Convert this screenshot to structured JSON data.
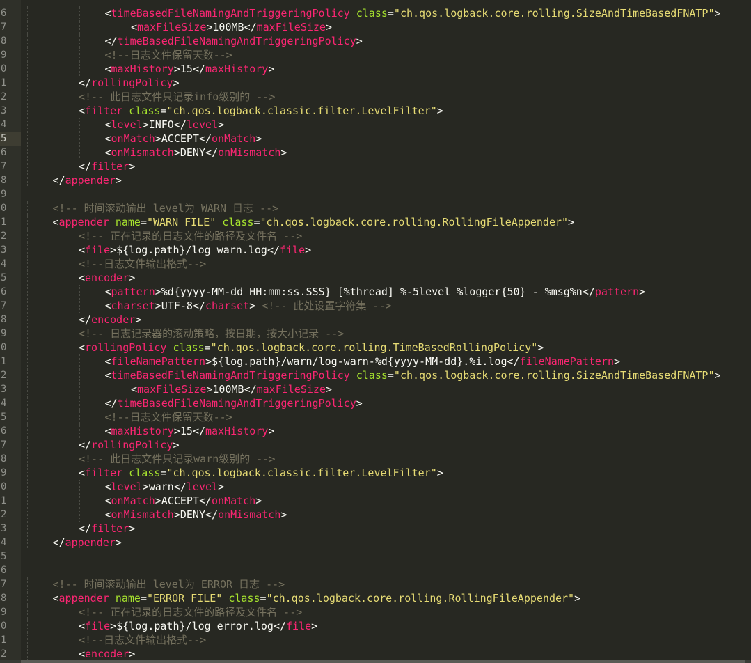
{
  "editor": {
    "active_line_index": 9,
    "lines": [
      {
        "num": "6",
        "indent": 3,
        "tokens": [
          [
            "br",
            "<"
          ],
          [
            "tag",
            "timeBasedFileNamingAndTriggeringPolicy"
          ],
          [
            "txt",
            " "
          ],
          [
            "attr",
            "class"
          ],
          [
            "br",
            "="
          ],
          [
            "str",
            "\"ch.qos.logback.core.rolling.SizeAndTimeBasedFNATP\""
          ],
          [
            "br",
            ">"
          ]
        ]
      },
      {
        "num": "7",
        "indent": 4,
        "tokens": [
          [
            "br",
            "<"
          ],
          [
            "tag",
            "maxFileSize"
          ],
          [
            "br",
            ">"
          ],
          [
            "txt",
            "100MB"
          ],
          [
            "br",
            "</"
          ],
          [
            "tag",
            "maxFileSize"
          ],
          [
            "br",
            ">"
          ]
        ]
      },
      {
        "num": "8",
        "indent": 3,
        "tokens": [
          [
            "br",
            "</"
          ],
          [
            "tag",
            "timeBasedFileNamingAndTriggeringPolicy"
          ],
          [
            "br",
            ">"
          ]
        ]
      },
      {
        "num": "9",
        "indent": 3,
        "tokens": [
          [
            "com",
            "<!--日志文件保留天数-->"
          ]
        ]
      },
      {
        "num": "0",
        "indent": 3,
        "tokens": [
          [
            "br",
            "<"
          ],
          [
            "tag",
            "maxHistory"
          ],
          [
            "br",
            ">"
          ],
          [
            "txt",
            "15"
          ],
          [
            "br",
            "</"
          ],
          [
            "tag",
            "maxHistory"
          ],
          [
            "br",
            ">"
          ]
        ]
      },
      {
        "num": "1",
        "indent": 2,
        "tokens": [
          [
            "br",
            "</"
          ],
          [
            "tag",
            "rollingPolicy"
          ],
          [
            "br",
            ">"
          ]
        ]
      },
      {
        "num": "2",
        "indent": 2,
        "tokens": [
          [
            "com",
            "<!-- 此日志文件只记录info级别的 -->"
          ]
        ]
      },
      {
        "num": "3",
        "indent": 2,
        "tokens": [
          [
            "br",
            "<"
          ],
          [
            "tag",
            "filter"
          ],
          [
            "txt",
            " "
          ],
          [
            "attr",
            "class"
          ],
          [
            "br",
            "="
          ],
          [
            "str",
            "\"ch.qos.logback.classic.filter.LevelFilter\""
          ],
          [
            "br",
            ">"
          ]
        ]
      },
      {
        "num": "4",
        "indent": 3,
        "tokens": [
          [
            "br",
            "<"
          ],
          [
            "tag",
            "level"
          ],
          [
            "br",
            ">"
          ],
          [
            "txt",
            "INFO"
          ],
          [
            "br",
            "</"
          ],
          [
            "tag",
            "level"
          ],
          [
            "br",
            ">"
          ]
        ]
      },
      {
        "num": "5",
        "indent": 3,
        "tokens": [
          [
            "br",
            "<"
          ],
          [
            "tag",
            "onMatch"
          ],
          [
            "br",
            ">"
          ],
          [
            "txt",
            "ACCEPT"
          ],
          [
            "br",
            "</"
          ],
          [
            "tag",
            "onMatch"
          ],
          [
            "br",
            ">"
          ]
        ]
      },
      {
        "num": "6",
        "indent": 3,
        "tokens": [
          [
            "br",
            "<"
          ],
          [
            "tag",
            "onMismatch"
          ],
          [
            "br",
            ">"
          ],
          [
            "txt",
            "DENY"
          ],
          [
            "br",
            "</"
          ],
          [
            "tag",
            "onMismatch"
          ],
          [
            "br",
            ">"
          ]
        ]
      },
      {
        "num": "7",
        "indent": 2,
        "tokens": [
          [
            "br",
            "</"
          ],
          [
            "tag",
            "filter"
          ],
          [
            "br",
            ">"
          ]
        ]
      },
      {
        "num": "8",
        "indent": 1,
        "tokens": [
          [
            "br",
            "</"
          ],
          [
            "tag",
            "appender"
          ],
          [
            "br",
            ">"
          ]
        ]
      },
      {
        "num": "9",
        "indent": 0,
        "tokens": []
      },
      {
        "num": "0",
        "indent": 1,
        "tokens": [
          [
            "com",
            "<!-- 时间滚动输出 level为 WARN 日志 -->"
          ]
        ]
      },
      {
        "num": "1",
        "indent": 1,
        "tokens": [
          [
            "br",
            "<"
          ],
          [
            "tag",
            "appender"
          ],
          [
            "txt",
            " "
          ],
          [
            "attr",
            "name"
          ],
          [
            "br",
            "="
          ],
          [
            "str",
            "\"WARN_FILE\""
          ],
          [
            "txt",
            " "
          ],
          [
            "attr",
            "class"
          ],
          [
            "br",
            "="
          ],
          [
            "str",
            "\"ch.qos.logback.core.rolling.RollingFileAppender\""
          ],
          [
            "br",
            ">"
          ]
        ]
      },
      {
        "num": "2",
        "indent": 2,
        "tokens": [
          [
            "com",
            "<!-- 正在记录的日志文件的路径及文件名 -->"
          ]
        ]
      },
      {
        "num": "3",
        "indent": 2,
        "tokens": [
          [
            "br",
            "<"
          ],
          [
            "tag",
            "file"
          ],
          [
            "br",
            ">"
          ],
          [
            "txt",
            "${log.path}/log_warn.log"
          ],
          [
            "br",
            "</"
          ],
          [
            "tag",
            "file"
          ],
          [
            "br",
            ">"
          ]
        ]
      },
      {
        "num": "4",
        "indent": 2,
        "tokens": [
          [
            "com",
            "<!--日志文件输出格式-->"
          ]
        ]
      },
      {
        "num": "5",
        "indent": 2,
        "tokens": [
          [
            "br",
            "<"
          ],
          [
            "tag",
            "encoder"
          ],
          [
            "br",
            ">"
          ]
        ]
      },
      {
        "num": "6",
        "indent": 3,
        "tokens": [
          [
            "br",
            "<"
          ],
          [
            "tag",
            "pattern"
          ],
          [
            "br",
            ">"
          ],
          [
            "txt",
            "%d{yyyy-MM-dd HH:mm:ss.SSS} [%thread] %-5level %logger{50} - %msg%n"
          ],
          [
            "br",
            "</"
          ],
          [
            "tag",
            "pattern"
          ],
          [
            "br",
            ">"
          ]
        ]
      },
      {
        "num": "7",
        "indent": 3,
        "tokens": [
          [
            "br",
            "<"
          ],
          [
            "tag",
            "charset"
          ],
          [
            "br",
            ">"
          ],
          [
            "txt",
            "UTF-8"
          ],
          [
            "br",
            "</"
          ],
          [
            "tag",
            "charset"
          ],
          [
            "br",
            ">"
          ],
          [
            "txt",
            " "
          ],
          [
            "com",
            "<!-- 此处设置字符集 -->"
          ]
        ]
      },
      {
        "num": "8",
        "indent": 2,
        "tokens": [
          [
            "br",
            "</"
          ],
          [
            "tag",
            "encoder"
          ],
          [
            "br",
            ">"
          ]
        ]
      },
      {
        "num": "9",
        "indent": 2,
        "tokens": [
          [
            "com",
            "<!-- 日志记录器的滚动策略，按日期，按大小记录 -->"
          ]
        ]
      },
      {
        "num": "0",
        "indent": 2,
        "tokens": [
          [
            "br",
            "<"
          ],
          [
            "tag",
            "rollingPolicy"
          ],
          [
            "txt",
            " "
          ],
          [
            "attr",
            "class"
          ],
          [
            "br",
            "="
          ],
          [
            "str",
            "\"ch.qos.logback.core.rolling.TimeBasedRollingPolicy\""
          ],
          [
            "br",
            ">"
          ]
        ]
      },
      {
        "num": "1",
        "indent": 3,
        "tokens": [
          [
            "br",
            "<"
          ],
          [
            "tag",
            "fileNamePattern"
          ],
          [
            "br",
            ">"
          ],
          [
            "txt",
            "${log.path}/warn/log-warn-%d{yyyy-MM-dd}.%i.log"
          ],
          [
            "br",
            "</"
          ],
          [
            "tag",
            "fileNamePattern"
          ],
          [
            "br",
            ">"
          ]
        ]
      },
      {
        "num": "2",
        "indent": 3,
        "tokens": [
          [
            "br",
            "<"
          ],
          [
            "tag",
            "timeBasedFileNamingAndTriggeringPolicy"
          ],
          [
            "txt",
            " "
          ],
          [
            "attr",
            "class"
          ],
          [
            "br",
            "="
          ],
          [
            "str",
            "\"ch.qos.logback.core.rolling.SizeAndTimeBasedFNATP\""
          ],
          [
            "br",
            ">"
          ]
        ]
      },
      {
        "num": "3",
        "indent": 4,
        "tokens": [
          [
            "br",
            "<"
          ],
          [
            "tag",
            "maxFileSize"
          ],
          [
            "br",
            ">"
          ],
          [
            "txt",
            "100MB"
          ],
          [
            "br",
            "</"
          ],
          [
            "tag",
            "maxFileSize"
          ],
          [
            "br",
            ">"
          ]
        ]
      },
      {
        "num": "4",
        "indent": 3,
        "tokens": [
          [
            "br",
            "</"
          ],
          [
            "tag",
            "timeBasedFileNamingAndTriggeringPolicy"
          ],
          [
            "br",
            ">"
          ]
        ]
      },
      {
        "num": "5",
        "indent": 3,
        "tokens": [
          [
            "com",
            "<!--日志文件保留天数-->"
          ]
        ]
      },
      {
        "num": "6",
        "indent": 3,
        "tokens": [
          [
            "br",
            "<"
          ],
          [
            "tag",
            "maxHistory"
          ],
          [
            "br",
            ">"
          ],
          [
            "txt",
            "15"
          ],
          [
            "br",
            "</"
          ],
          [
            "tag",
            "maxHistory"
          ],
          [
            "br",
            ">"
          ]
        ]
      },
      {
        "num": "7",
        "indent": 2,
        "tokens": [
          [
            "br",
            "</"
          ],
          [
            "tag",
            "rollingPolicy"
          ],
          [
            "br",
            ">"
          ]
        ]
      },
      {
        "num": "8",
        "indent": 2,
        "tokens": [
          [
            "com",
            "<!-- 此日志文件只记录warn级别的 -->"
          ]
        ]
      },
      {
        "num": "9",
        "indent": 2,
        "tokens": [
          [
            "br",
            "<"
          ],
          [
            "tag",
            "filter"
          ],
          [
            "txt",
            " "
          ],
          [
            "attr",
            "class"
          ],
          [
            "br",
            "="
          ],
          [
            "str",
            "\"ch.qos.logback.classic.filter.LevelFilter\""
          ],
          [
            "br",
            ">"
          ]
        ]
      },
      {
        "num": "0",
        "indent": 3,
        "tokens": [
          [
            "br",
            "<"
          ],
          [
            "tag",
            "level"
          ],
          [
            "br",
            ">"
          ],
          [
            "txt",
            "warn"
          ],
          [
            "br",
            "</"
          ],
          [
            "tag",
            "level"
          ],
          [
            "br",
            ">"
          ]
        ]
      },
      {
        "num": "1",
        "indent": 3,
        "tokens": [
          [
            "br",
            "<"
          ],
          [
            "tag",
            "onMatch"
          ],
          [
            "br",
            ">"
          ],
          [
            "txt",
            "ACCEPT"
          ],
          [
            "br",
            "</"
          ],
          [
            "tag",
            "onMatch"
          ],
          [
            "br",
            ">"
          ]
        ]
      },
      {
        "num": "2",
        "indent": 3,
        "tokens": [
          [
            "br",
            "<"
          ],
          [
            "tag",
            "onMismatch"
          ],
          [
            "br",
            ">"
          ],
          [
            "txt",
            "DENY"
          ],
          [
            "br",
            "</"
          ],
          [
            "tag",
            "onMismatch"
          ],
          [
            "br",
            ">"
          ]
        ]
      },
      {
        "num": "3",
        "indent": 2,
        "tokens": [
          [
            "br",
            "</"
          ],
          [
            "tag",
            "filter"
          ],
          [
            "br",
            ">"
          ]
        ]
      },
      {
        "num": "4",
        "indent": 1,
        "tokens": [
          [
            "br",
            "</"
          ],
          [
            "tag",
            "appender"
          ],
          [
            "br",
            ">"
          ]
        ]
      },
      {
        "num": "5",
        "indent": 0,
        "tokens": []
      },
      {
        "num": "6",
        "indent": 0,
        "tokens": []
      },
      {
        "num": "7",
        "indent": 1,
        "tokens": [
          [
            "com",
            "<!-- 时间滚动输出 level为 ERROR 日志 -->"
          ]
        ]
      },
      {
        "num": "8",
        "indent": 1,
        "tokens": [
          [
            "br",
            "<"
          ],
          [
            "tag",
            "appender"
          ],
          [
            "txt",
            " "
          ],
          [
            "attr",
            "name"
          ],
          [
            "br",
            "="
          ],
          [
            "str",
            "\"ERROR_FILE\""
          ],
          [
            "txt",
            " "
          ],
          [
            "attr",
            "class"
          ],
          [
            "br",
            "="
          ],
          [
            "str",
            "\"ch.qos.logback.core.rolling.RollingFileAppender\""
          ],
          [
            "br",
            ">"
          ]
        ]
      },
      {
        "num": "9",
        "indent": 2,
        "tokens": [
          [
            "com",
            "<!-- 正在记录的日志文件的路径及文件名 -->"
          ]
        ]
      },
      {
        "num": "0",
        "indent": 2,
        "tokens": [
          [
            "br",
            "<"
          ],
          [
            "tag",
            "file"
          ],
          [
            "br",
            ">"
          ],
          [
            "txt",
            "${log.path}/log_error.log"
          ],
          [
            "br",
            "</"
          ],
          [
            "tag",
            "file"
          ],
          [
            "br",
            ">"
          ]
        ]
      },
      {
        "num": "1",
        "indent": 2,
        "tokens": [
          [
            "com",
            "<!--日志文件输出格式-->"
          ]
        ]
      },
      {
        "num": "2",
        "indent": 2,
        "tokens": [
          [
            "br",
            "<"
          ],
          [
            "tag",
            "encoder"
          ],
          [
            "br",
            ">"
          ]
        ]
      }
    ]
  }
}
